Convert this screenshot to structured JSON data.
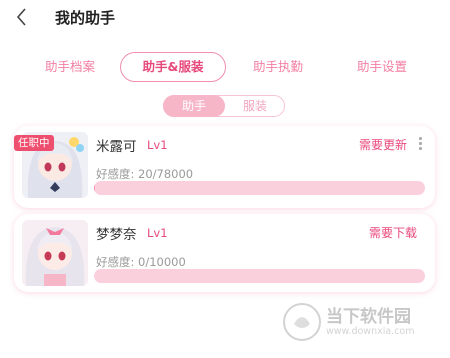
{
  "header": {
    "title": "我的助手",
    "back_icon": "chevron-left-icon"
  },
  "tabs": [
    {
      "label": "助手档案",
      "active": false
    },
    {
      "label": "助手&服装",
      "active": true
    },
    {
      "label": "助手执勤",
      "active": false
    },
    {
      "label": "助手设置",
      "active": false
    }
  ],
  "segment": {
    "selected": "助手",
    "other": "服装"
  },
  "assistants": [
    {
      "badge": "任职中",
      "name": "米露可",
      "level": "Lv1",
      "action": "需要更新",
      "favor_label": "好感度: 20/78000",
      "favor_fraction": 0.000256,
      "more_icon": "more-vertical-icon"
    },
    {
      "badge": "",
      "name": "梦梦奈",
      "level": "Lv1",
      "action": "需要下载",
      "favor_label": "好感度: 0/10000",
      "favor_fraction": 0
    }
  ],
  "watermark": {
    "text": "当下软件园",
    "url": "www.downxia.com"
  },
  "colors": {
    "accent": "#e8497c",
    "bar_bg": "#fad0dc",
    "badge": "#ef4f6e"
  }
}
